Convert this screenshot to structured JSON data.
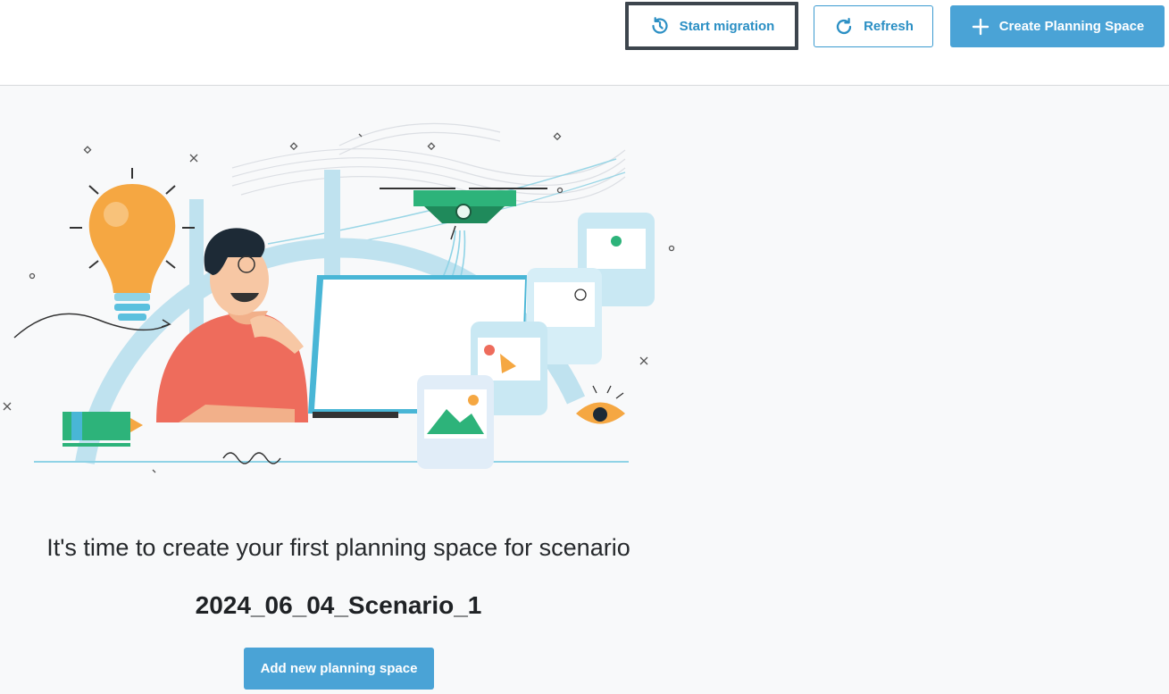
{
  "toolbar": {
    "start_migration_label": "Start migration",
    "refresh_label": "Refresh",
    "create_planning_space_label": "Create Planning Space"
  },
  "empty_state": {
    "message": "It's time to create your first planning space for scenario",
    "scenario_name": "2024_06_04_Scenario_1",
    "add_button_label": "Add new planning space"
  },
  "icons": {
    "start_migration": "clock-history-icon",
    "refresh": "refresh-icon",
    "create": "plus-icon"
  },
  "colors": {
    "accent": "#4aa3d6",
    "accent_text": "#2b8fc4",
    "focus_border": "#3d454d",
    "background": "#f8f9fa"
  }
}
